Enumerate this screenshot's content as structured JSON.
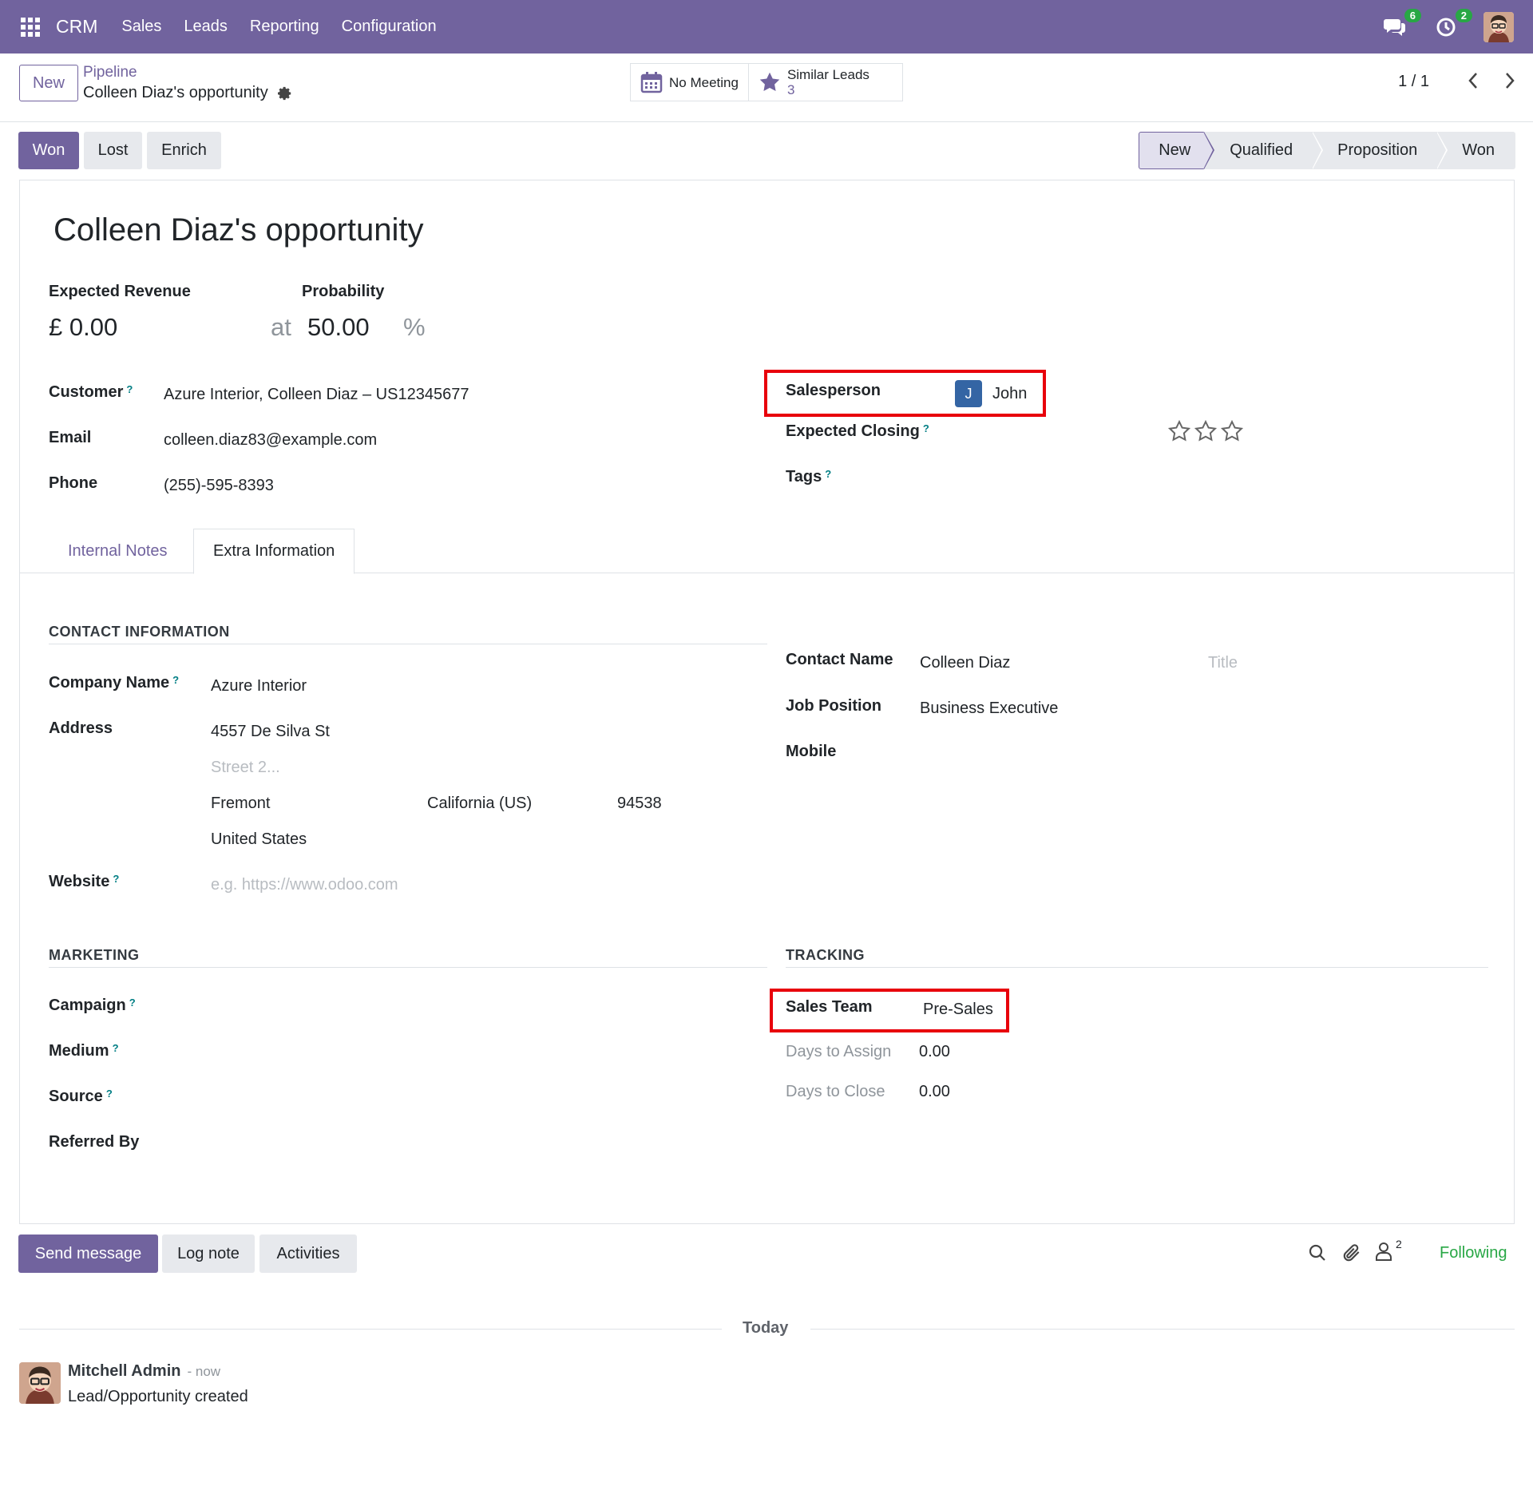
{
  "navbar": {
    "app_name": "CRM",
    "menu": [
      "Sales",
      "Leads",
      "Reporting",
      "Configuration"
    ],
    "messages_badge": "6",
    "activities_badge": "2",
    "icons": [
      "apps-grid-icon",
      "chat-icon",
      "clock-icon",
      "user-avatar"
    ]
  },
  "control": {
    "new_label": "New",
    "breadcrumb_parent": "Pipeline",
    "breadcrumb_current": "Colleen Diaz's opportunity",
    "meeting_label": "No Meeting",
    "similar_label": "Similar Leads",
    "similar_count": "3",
    "pager": "1 / 1"
  },
  "actions": {
    "won": "Won",
    "lost": "Lost",
    "enrich": "Enrich"
  },
  "stages": [
    "New",
    "Qualified",
    "Proposition",
    "Won"
  ],
  "form": {
    "title": "Colleen Diaz's opportunity",
    "expected_revenue_label": "Expected Revenue",
    "expected_revenue": "£ 0.00",
    "at": "at",
    "probability_label": "Probability",
    "probability": "50.00",
    "percent": "%",
    "customer_label": "Customer",
    "customer": "Azure Interior, Colleen Diaz – US12345677",
    "email_label": "Email",
    "email": "colleen.diaz83@example.com",
    "phone_label": "Phone",
    "phone": "(255)-595-8393",
    "salesperson_label": "Salesperson",
    "salesperson_initial": "J",
    "salesperson": "John",
    "expected_closing_label": "Expected Closing",
    "tags_label": "Tags",
    "help_mark": "?",
    "priority_stars_filled": 0,
    "priority_stars_total": 3
  },
  "tabs": [
    "Internal Notes",
    "Extra Information"
  ],
  "extra": {
    "contact_section": "CONTACT INFORMATION",
    "company_name_label": "Company Name",
    "company_name": "Azure Interior",
    "address_label": "Address",
    "street": "4557 De Silva St",
    "street2_placeholder": "Street 2...",
    "city": "Fremont",
    "state": "California (US)",
    "zip": "94538",
    "country": "United States",
    "website_label": "Website",
    "website_placeholder": "e.g. https://www.odoo.com",
    "contact_name_label": "Contact Name",
    "contact_name": "Colleen Diaz",
    "title_placeholder": "Title",
    "job_position_label": "Job Position",
    "job_position": "Business Executive",
    "mobile_label": "Mobile",
    "marketing_section": "MARKETING",
    "campaign_label": "Campaign",
    "medium_label": "Medium",
    "source_label": "Source",
    "referred_label": "Referred By",
    "tracking_section": "TRACKING",
    "sales_team_label": "Sales Team",
    "sales_team": "Pre-Sales",
    "days_assign_label": "Days to Assign",
    "days_assign": "0.00",
    "days_close_label": "Days to Close",
    "days_close": "0.00"
  },
  "chatter": {
    "send_message": "Send message",
    "log_note": "Log note",
    "activities": "Activities",
    "followers_count": "2",
    "following": "Following",
    "today": "Today",
    "author": "Mitchell Admin",
    "time": "- now",
    "body": "Lead/Opportunity created"
  },
  "colors": {
    "brand": "#71639e",
    "highlight": "#e8000b",
    "following": "#28a745"
  }
}
